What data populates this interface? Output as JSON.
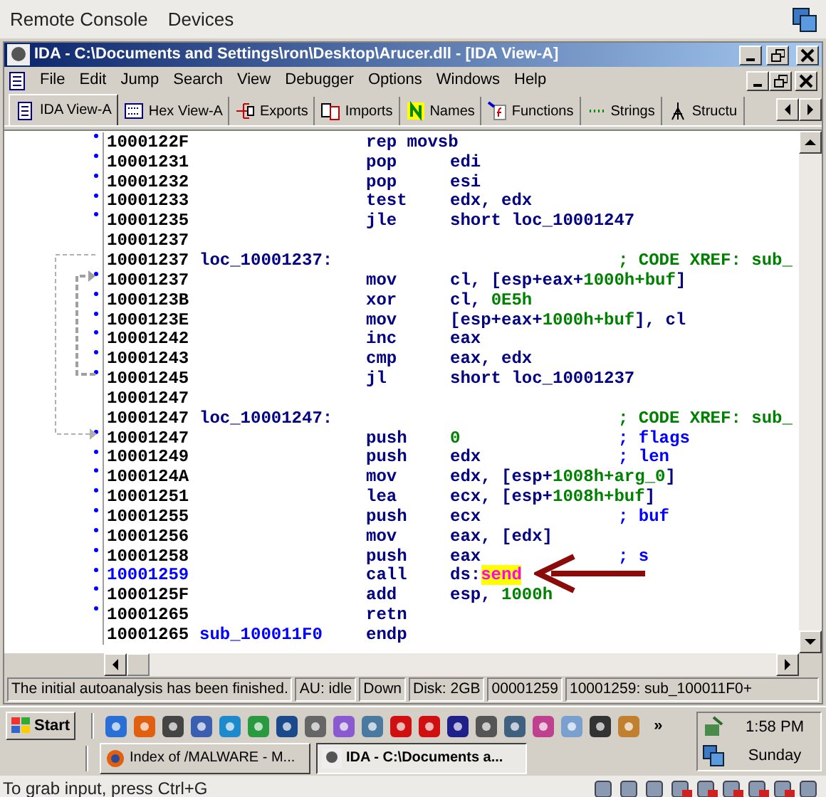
{
  "host_menu": [
    {
      "label": "Remote Console"
    },
    {
      "label": "Devices"
    }
  ],
  "window": {
    "title": "IDA - C:\\Documents and Settings\\ron\\Desktop\\Arucer.dll - [IDA View-A]"
  },
  "menu": [
    {
      "label": "File"
    },
    {
      "label": "Edit"
    },
    {
      "label": "Jump"
    },
    {
      "label": "Search"
    },
    {
      "label": "View"
    },
    {
      "label": "Debugger"
    },
    {
      "label": "Options"
    },
    {
      "label": "Windows"
    },
    {
      "label": "Help"
    }
  ],
  "tabs": [
    {
      "label": "IDA View-A",
      "selected": true
    },
    {
      "label": "Hex View-A",
      "selected": false
    },
    {
      "label": "Exports",
      "selected": false
    },
    {
      "label": "Imports",
      "selected": false
    },
    {
      "label": "Names",
      "selected": false
    },
    {
      "label": "Functions",
      "selected": false
    },
    {
      "label": "Strings",
      "selected": false
    },
    {
      "label": "Structu",
      "selected": false
    }
  ],
  "disassembly": [
    {
      "address": "1000122F",
      "dot": true,
      "current": false,
      "mnemonic": "rep movsb"
    },
    {
      "address": "10001231",
      "dot": true,
      "current": false,
      "mnemonic": "pop",
      "operands": [
        {
          "text": "edi",
          "kind": "plain"
        }
      ]
    },
    {
      "address": "10001232",
      "dot": true,
      "current": false,
      "mnemonic": "pop",
      "operands": [
        {
          "text": "esi",
          "kind": "plain"
        }
      ]
    },
    {
      "address": "10001233",
      "dot": true,
      "current": false,
      "mnemonic": "test",
      "operands": [
        {
          "text": "edx, edx",
          "kind": "plain"
        }
      ]
    },
    {
      "address": "10001235",
      "dot": true,
      "current": false,
      "mnemonic": "jle",
      "operands": [
        {
          "text": "short loc_10001247",
          "kind": "plain"
        }
      ]
    },
    {
      "address": "10001237",
      "dot": false,
      "current": false
    },
    {
      "address": "10001237",
      "dot": false,
      "current": false,
      "label": "loc_10001237:",
      "comment": {
        "text": "; CODE XREF: sub_",
        "kind": "xref"
      }
    },
    {
      "address": "10001237",
      "dot": true,
      "current": false,
      "mnemonic": "mov",
      "operands": [
        {
          "text": "cl, [esp+eax+",
          "kind": "plain"
        },
        {
          "text": "1000h+buf",
          "kind": "number"
        },
        {
          "text": "]",
          "kind": "plain"
        }
      ]
    },
    {
      "address": "1000123B",
      "dot": true,
      "current": false,
      "mnemonic": "xor",
      "operands": [
        {
          "text": "cl, ",
          "kind": "plain"
        },
        {
          "text": "0E5h",
          "kind": "number"
        }
      ]
    },
    {
      "address": "1000123E",
      "dot": true,
      "current": false,
      "mnemonic": "mov",
      "operands": [
        {
          "text": "[esp+eax+",
          "kind": "plain"
        },
        {
          "text": "1000h+buf",
          "kind": "number"
        },
        {
          "text": "], cl",
          "kind": "plain"
        }
      ]
    },
    {
      "address": "10001242",
      "dot": true,
      "current": false,
      "mnemonic": "inc",
      "operands": [
        {
          "text": "eax",
          "kind": "plain"
        }
      ]
    },
    {
      "address": "10001243",
      "dot": true,
      "current": false,
      "mnemonic": "cmp",
      "operands": [
        {
          "text": "eax, edx",
          "kind": "plain"
        }
      ]
    },
    {
      "address": "10001245",
      "dot": true,
      "current": false,
      "mnemonic": "jl",
      "operands": [
        {
          "text": "short loc_10001237",
          "kind": "plain"
        }
      ]
    },
    {
      "address": "10001247",
      "dot": false,
      "current": false
    },
    {
      "address": "10001247",
      "dot": false,
      "current": false,
      "label": "loc_10001247:",
      "comment": {
        "text": "; CODE XREF: sub_",
        "kind": "xref"
      }
    },
    {
      "address": "10001247",
      "dot": true,
      "current": false,
      "mnemonic": "push",
      "operands": [
        {
          "text": "0",
          "kind": "number"
        }
      ],
      "comment": {
        "text": "; flags",
        "kind": "arg"
      }
    },
    {
      "address": "10001249",
      "dot": true,
      "current": false,
      "mnemonic": "push",
      "operands": [
        {
          "text": "edx",
          "kind": "plain"
        }
      ],
      "comment": {
        "text": "; len",
        "kind": "arg"
      }
    },
    {
      "address": "1000124A",
      "dot": true,
      "current": false,
      "mnemonic": "mov",
      "operands": [
        {
          "text": "edx, [esp+",
          "kind": "plain"
        },
        {
          "text": "1008h+arg_0",
          "kind": "number"
        },
        {
          "text": "]",
          "kind": "plain"
        }
      ]
    },
    {
      "address": "10001251",
      "dot": true,
      "current": false,
      "mnemonic": "lea",
      "operands": [
        {
          "text": "ecx, [esp+",
          "kind": "plain"
        },
        {
          "text": "1008h+buf",
          "kind": "number"
        },
        {
          "text": "]",
          "kind": "plain"
        }
      ]
    },
    {
      "address": "10001255",
      "dot": true,
      "current": false,
      "mnemonic": "push",
      "operands": [
        {
          "text": "ecx",
          "kind": "plain"
        }
      ],
      "comment": {
        "text": "; buf",
        "kind": "arg"
      }
    },
    {
      "address": "10001256",
      "dot": true,
      "current": false,
      "mnemonic": "mov",
      "operands": [
        {
          "text": "eax, [edx]",
          "kind": "plain"
        }
      ]
    },
    {
      "address": "10001258",
      "dot": true,
      "current": false,
      "mnemonic": "push",
      "operands": [
        {
          "text": "eax",
          "kind": "plain"
        }
      ],
      "comment": {
        "text": "; s",
        "kind": "arg"
      }
    },
    {
      "address": "10001259",
      "dot": true,
      "current": true,
      "mnemonic": "call",
      "operands": [
        {
          "text": "ds:",
          "kind": "plain"
        },
        {
          "text": "send",
          "kind": "import"
        }
      ]
    },
    {
      "address": "1000125F",
      "dot": true,
      "current": false,
      "mnemonic": "add",
      "operands": [
        {
          "text": "esp, ",
          "kind": "plain"
        },
        {
          "text": "1000h",
          "kind": "number"
        }
      ]
    },
    {
      "address": "10001265",
      "dot": true,
      "current": false,
      "mnemonic": "retn"
    },
    {
      "address": "10001265",
      "dot": false,
      "current": false,
      "label": "sub_100011F0",
      "mnemonic": "endp"
    }
  ],
  "status_bar": [
    "The initial autoanalysis has been finished.",
    "AU:  idle",
    "Down",
    "Disk: 2GB",
    "00001259",
    "10001259: sub_100011F0+"
  ],
  "taskbar": {
    "start": "Start",
    "more": "»",
    "tasks": [
      {
        "label": "Index of /MALWARE - M...",
        "selected": false
      },
      {
        "label": "IDA - C:\\Documents a...",
        "selected": true
      }
    ],
    "clock": "1:58 PM",
    "day": "Sunday"
  },
  "host_status": "To grab input, press Ctrl+G"
}
